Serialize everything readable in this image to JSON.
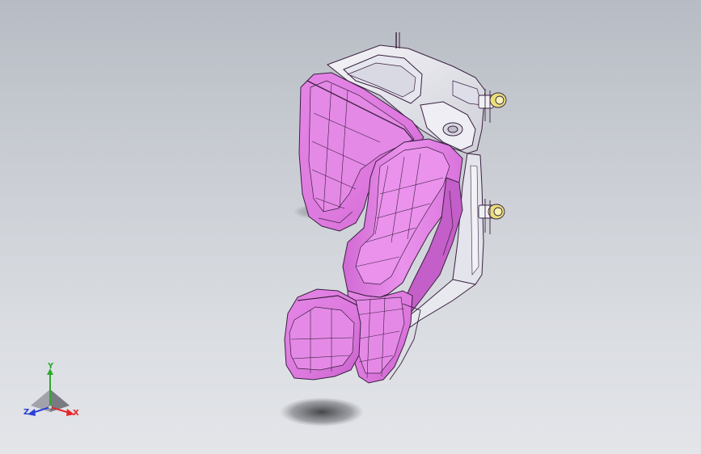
{
  "viewport": {
    "background_top": "#b7bcc4",
    "background_bottom": "#e3e5e9"
  },
  "model": {
    "icon": "car-seat-3d-model",
    "body_color": "#e07ee0",
    "body_dark": "#c45ec8",
    "frame_color": "#ececf2",
    "edge_color": "#3a2040",
    "fastener_color": "#e8e07a"
  },
  "triad": {
    "x_label": "X",
    "y_label": "Y",
    "z_label": "Z",
    "x_color": "#e8262a",
    "y_color": "#2fa82f",
    "z_color": "#2b3fd8"
  }
}
